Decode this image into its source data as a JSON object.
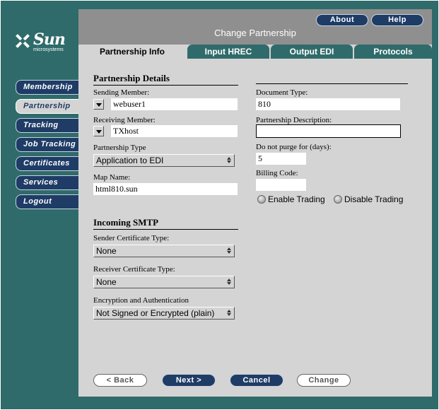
{
  "brand": {
    "logo_text": "Sun",
    "logo_sub": "microsystems"
  },
  "header": {
    "title": "Change Partnership",
    "about_label": "About",
    "help_label": "Help"
  },
  "nav": {
    "items": [
      {
        "label": "Membership",
        "active": false
      },
      {
        "label": "Partnership",
        "active": true
      },
      {
        "label": "Tracking",
        "active": false
      },
      {
        "label": "Job Tracking",
        "active": false
      },
      {
        "label": "Certificates",
        "active": false
      },
      {
        "label": "Services",
        "active": false
      },
      {
        "label": "Logout",
        "active": false
      }
    ]
  },
  "tabs": [
    {
      "label": "Partnership Info",
      "active": true
    },
    {
      "label": "Input HREC",
      "active": false
    },
    {
      "label": "Output EDI",
      "active": false
    },
    {
      "label": "Protocols",
      "active": false
    }
  ],
  "details": {
    "section_title": "Partnership Details",
    "sending_member_label": "Sending Member:",
    "sending_member_value": "webuser1",
    "receiving_member_label": "Receiving Member:",
    "receiving_member_value": "TXhost",
    "partnership_type_label": "Partnership Type",
    "partnership_type_value": "Application to EDI",
    "map_name_label": "Map Name:",
    "map_name_value": "html810.sun"
  },
  "right": {
    "document_type_label": "Document Type:",
    "document_type_value": "810",
    "description_label": "Partnership Description:",
    "description_value": "",
    "purge_label": "Do not purge for (days):",
    "purge_value": "5",
    "billing_label": "Billing Code:",
    "billing_value": "",
    "enable_trading_label": "Enable Trading",
    "disable_trading_label": "Disable Trading"
  },
  "smtp": {
    "section_title": "Incoming SMTP",
    "sender_cert_label": "Sender Certificate Type:",
    "sender_cert_value": "None",
    "receiver_cert_label": "Receiver Certificate Type:",
    "receiver_cert_value": "None",
    "encryption_label": "Encryption and Authentication",
    "encryption_value": "Not Signed or Encrypted (plain)"
  },
  "buttons": {
    "back_label": "< Back",
    "next_label": "Next >",
    "cancel_label": "Cancel",
    "change_label": "Change"
  },
  "colors": {
    "frame": "#2f6b6a",
    "panel": "#d4d4d4",
    "header": "#8f8f8f",
    "nav_button": "#1f3c66"
  }
}
